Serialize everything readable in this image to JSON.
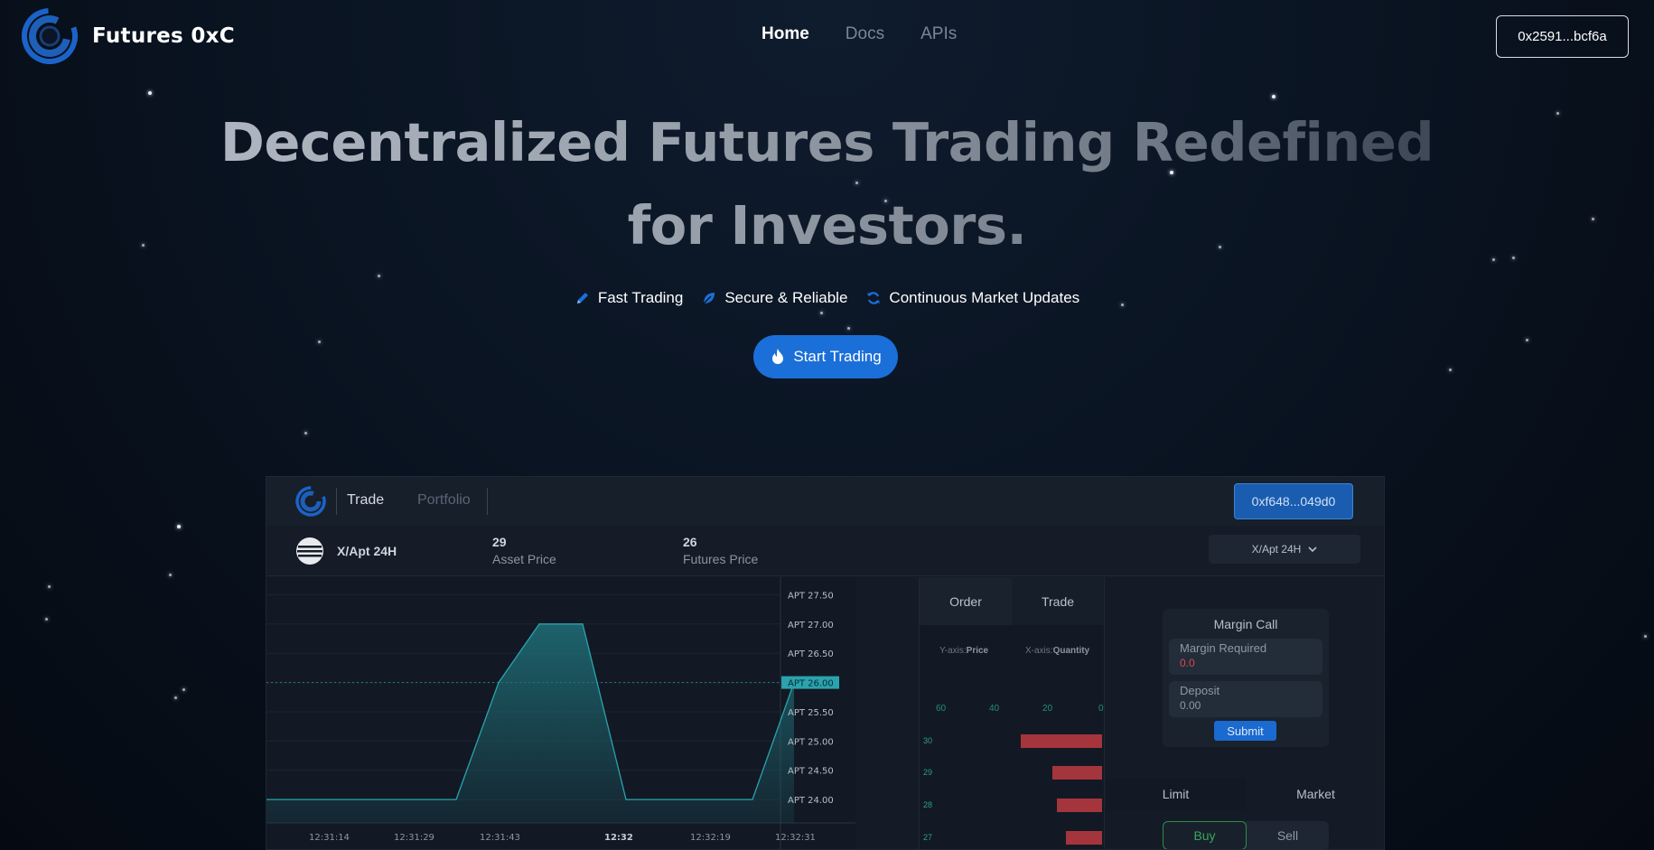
{
  "nav": {
    "brand": "Futures 0xC",
    "links": [
      {
        "label": "Home",
        "active": true
      },
      {
        "label": "Docs",
        "active": false
      },
      {
        "label": "APIs",
        "active": false
      }
    ],
    "wallet": "0x2591...bcf6a"
  },
  "hero": {
    "title_line1": "Decentralized Futures Trading Redefined",
    "title_line2": "for Investors.",
    "features": [
      {
        "icon": "pencil-icon",
        "label": "Fast Trading"
      },
      {
        "icon": "leaf-icon",
        "label": "Secure & Reliable"
      },
      {
        "icon": "refresh-icon",
        "label": "Continuous Market Updates"
      }
    ],
    "cta": "Start Trading",
    "cta_icon": "flame-icon"
  },
  "app": {
    "tabs": {
      "trade": "Trade",
      "portfolio": "Portfolio"
    },
    "wallet": "0xf648...049d0",
    "pair": "X/Apt 24H",
    "asset_price": {
      "value": "29",
      "label": "Asset Price"
    },
    "futures_price": {
      "value": "26",
      "label": "Futures Price"
    },
    "pair_select": "X/Apt 24H",
    "order_tabs": {
      "order": "Order",
      "trade": "Trade"
    },
    "axis_info": {
      "y_prefix": "Y-axis:",
      "y_value": "Price",
      "x_prefix": "X-axis:",
      "x_value": "Quantity"
    },
    "qty_ticks": [
      "60",
      "40",
      "20",
      "0"
    ],
    "order_book": [
      {
        "price": "30",
        "qty": 36
      },
      {
        "price": "29",
        "qty": 22
      },
      {
        "price": "28",
        "qty": 20
      },
      {
        "price": "27",
        "qty": 16
      }
    ],
    "margin_call": {
      "title": "Margin Call",
      "required_label": "Margin Required",
      "required_value": "0.0",
      "deposit_label": "Deposit",
      "deposit_value": "0.00",
      "submit": "Submit"
    },
    "order_type_tabs": [
      "Limit",
      "Market"
    ],
    "side_buttons": [
      "Buy",
      "Sell"
    ]
  },
  "colors": {
    "accent": "#1b6fd8",
    "chart_fill": "#1f6f78",
    "chart_line": "#2aa3ad",
    "price_tag": "#2aa3ad",
    "sell_bar": "#a5353c",
    "negative": "#d9484f",
    "buy": "#35a85a"
  },
  "chart_data": {
    "type": "area",
    "y_tick_labels": [
      "APT 27.50",
      "APT 27.00",
      "APT 26.50",
      "APT 26.00",
      "APT 25.50",
      "APT 25.00",
      "APT 24.50",
      "APT 24.00"
    ],
    "x_tick_labels": [
      "12:31:14",
      "12:31:29",
      "12:31:43",
      "12:32",
      "12:32:19",
      "12:32:31"
    ],
    "current_price_label": "APT 26.00",
    "current_price": 26.0,
    "ylim": [
      23.6,
      27.8
    ],
    "points": [
      {
        "t": 0,
        "price": 24.0
      },
      {
        "t": 210,
        "price": 24.0
      },
      {
        "t": 257,
        "price": 26.0
      },
      {
        "t": 302,
        "price": 27.0
      },
      {
        "t": 350,
        "price": 27.0
      },
      {
        "t": 398,
        "price": 24.0
      },
      {
        "t": 538,
        "price": 24.0
      },
      {
        "t": 584,
        "price": 26.0
      }
    ]
  }
}
